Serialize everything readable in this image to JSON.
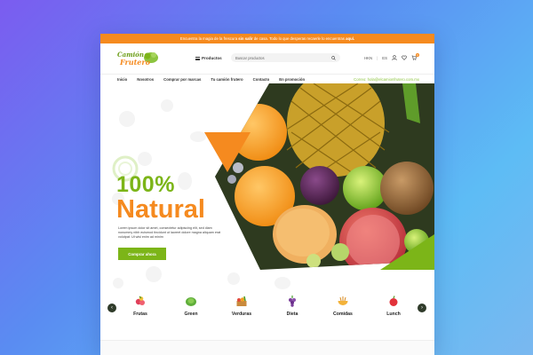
{
  "topbar": {
    "prefix": "Encuentra la magia de la frescura ",
    "highlight1": "sin salir",
    "middle": " de casa. Todo lo que desperas recaerle lo encuentras ",
    "highlight2": "aquí.",
    "bg_color": "#f58a1f"
  },
  "header": {
    "logo_text": "Camión Frutero",
    "products_label": "Productos",
    "search_placeholder": "Buscar productos",
    "currency": "HKN",
    "language": "ES",
    "cart_count": "0"
  },
  "nav": {
    "items": [
      "Inicio",
      "Nosotros",
      "Comprar por marcas",
      "Tu camión frutero",
      "Contacto",
      "En promoción"
    ],
    "email": "Correo: hola@elcamionfrutero.com.mx"
  },
  "hero": {
    "headline1": "100%",
    "headline2": "Natural",
    "body": "Lorem ipsum dolor sit amet, consectetur adipiscing elit, sed diam nonummy nibh euismod tincidunt ut laoreet dolore magna aliquam erat volutpat. Ut wisi enim ad minim",
    "cta": "Comprar ahora",
    "green": "#7cb518",
    "orange": "#f58a1f"
  },
  "categories": [
    {
      "label": "Frutas",
      "icon": "berries-icon"
    },
    {
      "label": "Green",
      "icon": "lettuce-icon"
    },
    {
      "label": "Verduras",
      "icon": "vegetable-crate-icon"
    },
    {
      "label": "Dieta",
      "icon": "grapes-icon"
    },
    {
      "label": "Comidas",
      "icon": "noodles-icon"
    },
    {
      "label": "Lunch",
      "icon": "apple-icon"
    }
  ]
}
